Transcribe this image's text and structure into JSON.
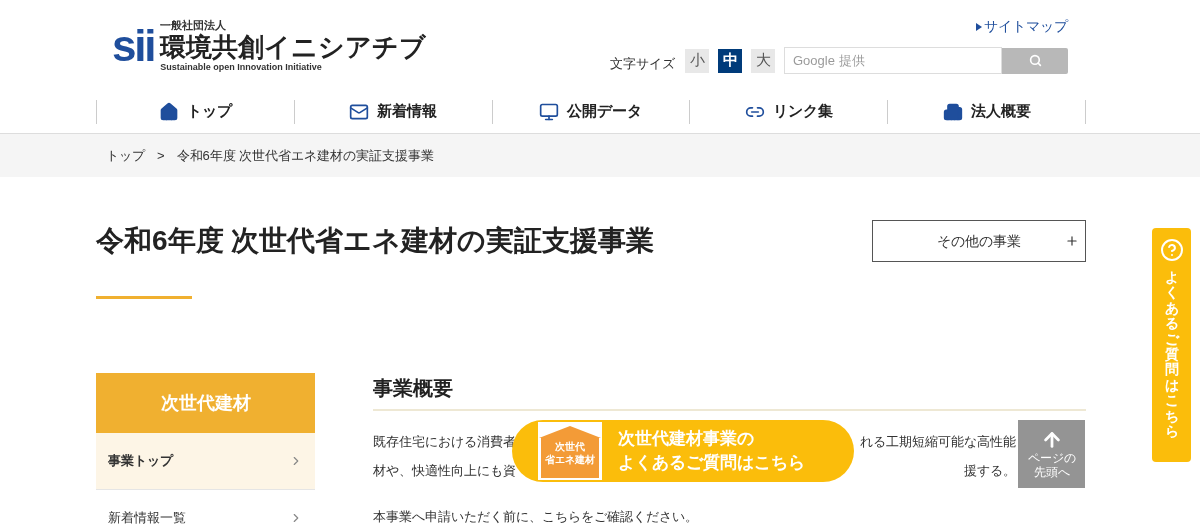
{
  "header": {
    "logo_mark": "sii",
    "org_type": "一般社団法人",
    "org_name": "環境共創イニシアチブ",
    "org_english": "Sustainable open Innovation Initiative",
    "sitemap_link": "サイトマップ",
    "font_size_label": "文字サイズ",
    "font_sizes": [
      {
        "label": "小",
        "selected": false
      },
      {
        "label": "中",
        "selected": true
      },
      {
        "label": "大",
        "selected": false
      }
    ],
    "search_placeholder": "Google 提供"
  },
  "nav": [
    {
      "label": "トップ",
      "kind": "home"
    },
    {
      "label": "新着情報",
      "kind": "mail"
    },
    {
      "label": "公開データ",
      "kind": "monitor"
    },
    {
      "label": "リンク集",
      "kind": "link"
    },
    {
      "label": "法人概要",
      "kind": "building"
    }
  ],
  "breadcrumb": [
    "トップ",
    "令和6年度 次世代省エネ建材の実証支援事業"
  ],
  "breadcrumb_separator": ">",
  "page_title": "令和6年度 次世代省エネ建材の実証支援事業",
  "other_projects_button": "その他の事業",
  "sidebar": {
    "title": "次世代建材",
    "items": [
      {
        "label": "事業トップ",
        "selected": true
      },
      {
        "label": "新着情報一覧",
        "selected": false
      }
    ]
  },
  "section_heading": "事業概要",
  "paragraph_lines": [
    {
      "left": "既存住宅における消費者",
      "right": "れる工期短縮可能な高性能"
    },
    {
      "left": "材や、快適性向上にも資",
      "right": "援する。"
    }
  ],
  "notice": "本事業へ申請いただく前に、こちらをご確認ください。",
  "faq_banner": {
    "badge": [
      "次世代",
      "省エネ建材"
    ],
    "line1": "次世代建材事業の",
    "line2": "よくあるご質問はこちら"
  },
  "page_top": "ページの先頭へ",
  "faq_tab": "よくあるご質問はこちら"
}
